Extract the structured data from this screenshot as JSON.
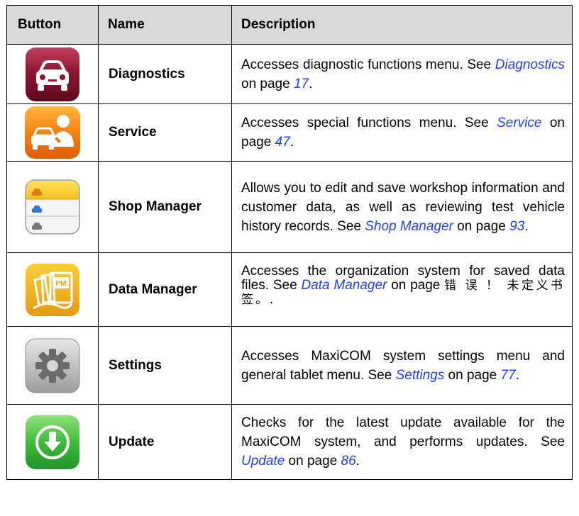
{
  "header": {
    "col_button": "Button",
    "col_name": "Name",
    "col_description": "Description"
  },
  "rows": [
    {
      "name": "Diagnostics",
      "desc_before": "Accesses diagnostic functions menu. See ",
      "link": "Diagnostics",
      "desc_middle": " on page ",
      "page": "17",
      "desc_after": ".",
      "icon": "car-icon",
      "color": "#8a1630"
    },
    {
      "name": "Service",
      "desc_before": "Accesses special functions menu. See ",
      "link": "Service",
      "desc_middle": " on page ",
      "page": "47",
      "desc_after": ".",
      "icon": "car-mechanic-icon",
      "color": "#f07a10"
    },
    {
      "name": "Shop Manager",
      "desc_before": "Allows you to edit and save workshop information and customer data, as well as reviewing test vehicle history records. See ",
      "link": "Shop Manager",
      "desc_middle": " on page ",
      "page": "93",
      "desc_after": ".",
      "icon": "notepad-cars-icon",
      "color": "#f7d23a"
    },
    {
      "name": "Data Manager",
      "desc_before": "Accesses the organization system for saved data files. See ",
      "link": "Data Manager",
      "desc_middle": " on page ",
      "page": "错 误 ！ 未定义书签。",
      "desc_after": ".",
      "icon": "files-icon",
      "color": "#e8a818"
    },
    {
      "name": "Settings",
      "desc_before": "Accesses MaxiCOM system settings menu and general tablet menu. See ",
      "link": "Settings",
      "desc_middle": " on page ",
      "page": "77",
      "desc_after": ".",
      "icon": "gear-icon",
      "color": "#a8a8a8"
    },
    {
      "name": "Update",
      "desc_before": "Checks for the latest update available for the MaxiCOM system, and performs updates. See ",
      "link": "Update",
      "desc_middle": " on page ",
      "page": "86",
      "desc_after": ".",
      "icon": "download-arrow-icon",
      "color": "#3cb83c"
    }
  ]
}
